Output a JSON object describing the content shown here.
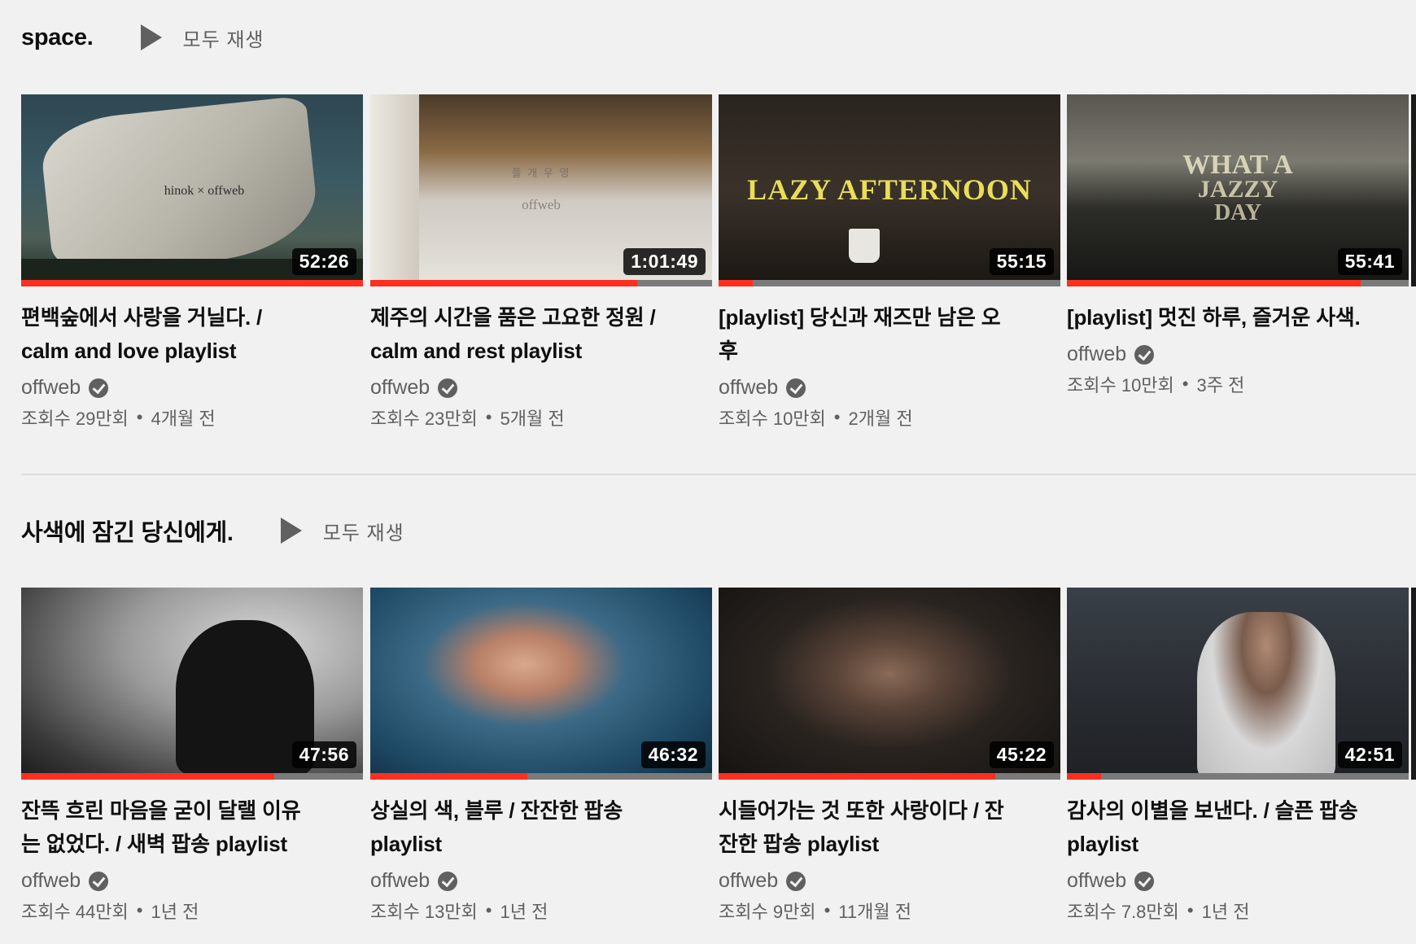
{
  "colors": {
    "accent": "#ff2f1f",
    "background": "#f1f1f1",
    "muted_text": "#606060"
  },
  "shelves": [
    {
      "title": "space.",
      "play_all": "모두 재생",
      "videos": [
        {
          "title_line1": "편백숲에서 사랑을 거닐다. /",
          "title_line2": "calm and love playlist",
          "thumb_text": "hinok × offweb",
          "duration": "52:26",
          "progress": 1.0,
          "channel": "offweb",
          "views": "조회수 29만회",
          "age": "4개월 전"
        },
        {
          "title_line1": "제주의 시간을 품은 고요한 정원 /",
          "title_line2": "calm and rest playlist",
          "thumb_text": "플 개 우 영",
          "thumb_text2": "offweb",
          "duration": "1:01:49",
          "progress": 0.78,
          "channel": "offweb",
          "views": "조회수 23만회",
          "age": "5개월 전"
        },
        {
          "title_line1": "[playlist] 당신과 재즈만 남은 오",
          "title_line2": "후",
          "thumb_text": "LAZY AFTERNOON",
          "duration": "55:15",
          "progress": 0.1,
          "channel": "offweb",
          "views": "조회수 10만회",
          "age": "2개월 전"
        },
        {
          "title_line1": "[playlist] 멋진 하루, 즐거운 사색.",
          "title_line2": "",
          "thumb_text": "WHAT A",
          "thumb_text2": "JAZZY",
          "thumb_text3": "DAY",
          "duration": "55:41",
          "progress": 0.86,
          "channel": "offweb",
          "views": "조회수 10만회",
          "age": "3주 전"
        }
      ]
    },
    {
      "title": "사색에 잠긴 당신에게.",
      "play_all": "모두 재생",
      "videos": [
        {
          "title_line1": "잔뜩 흐린 마음을 굳이 달랠 이유",
          "title_line2": "는 없었다. / 새벽 팝송 playlist",
          "duration": "47:56",
          "progress": 0.74,
          "channel": "offweb",
          "views": "조회수 44만회",
          "age": "1년 전"
        },
        {
          "title_line1": "상실의 색, 블루 / 잔잔한 팝송",
          "title_line2": "playlist",
          "duration": "46:32",
          "progress": 0.46,
          "channel": "offweb",
          "views": "조회수 13만회",
          "age": "1년 전"
        },
        {
          "title_line1": "시들어가는 것 또한 사랑이다 / 잔",
          "title_line2": "잔한 팝송 playlist",
          "duration": "45:22",
          "progress": 0.81,
          "channel": "offweb",
          "views": "조회수 9만회",
          "age": "11개월 전"
        },
        {
          "title_line1": "감사의 이별을 보낸다. / 슬픈 팝송",
          "title_line2": "playlist",
          "duration": "42:51",
          "progress": 0.1,
          "channel": "offweb",
          "views": "조회수 7.8만회",
          "age": "1년 전"
        }
      ]
    }
  ]
}
